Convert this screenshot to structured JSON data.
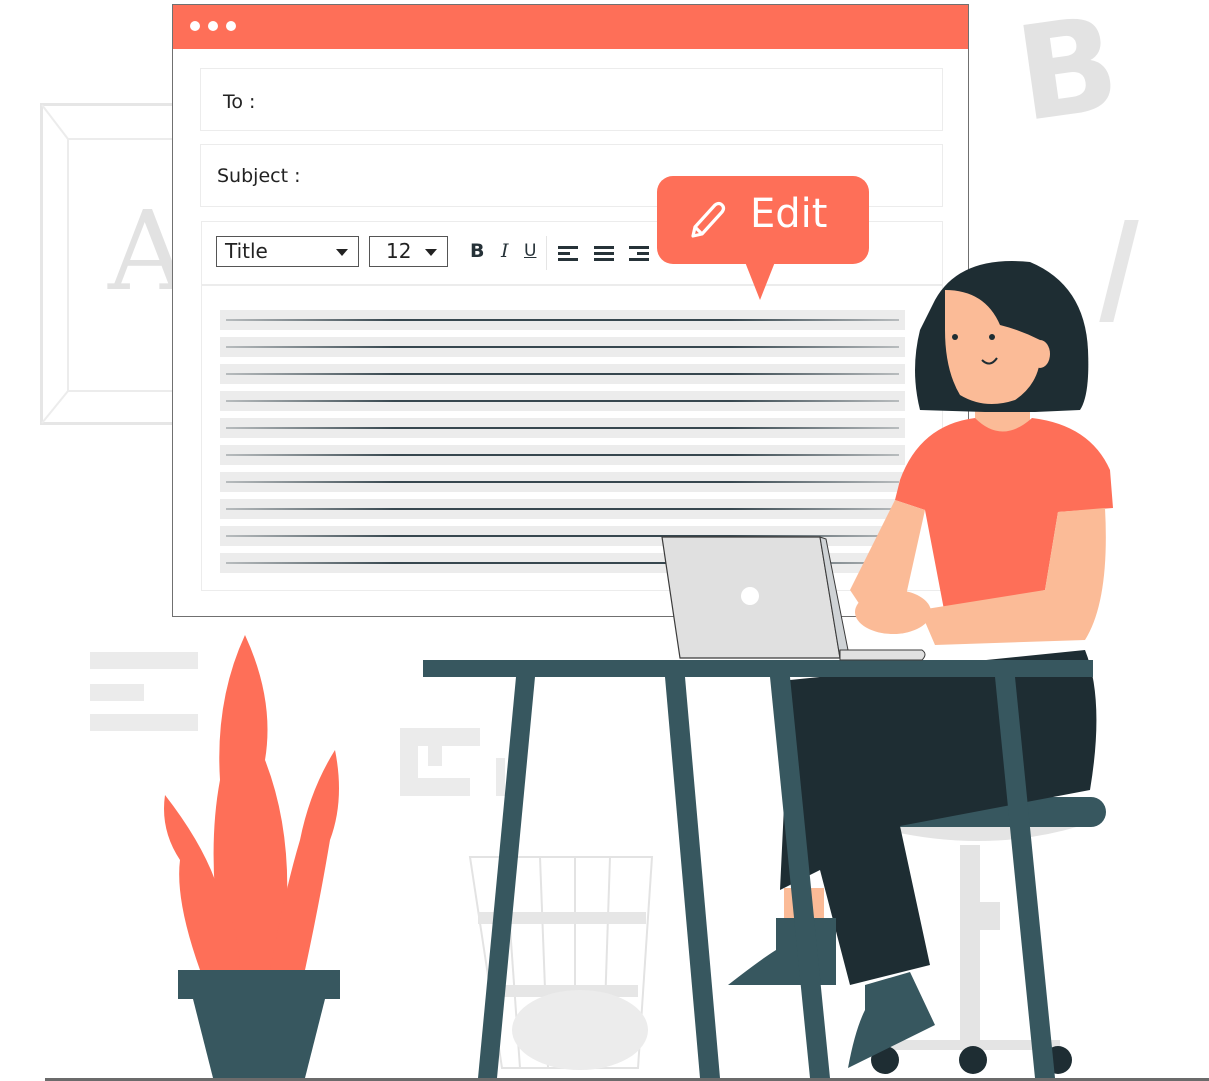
{
  "window": {
    "title_dots": 3,
    "accent_color": "#fe6f58",
    "to_label": "To :",
    "to_value": "",
    "subject_label": "Subject :",
    "subject_value": ""
  },
  "toolbar": {
    "style_select": "Title",
    "size_select": "12",
    "bold_label": "B",
    "italic_label": "I",
    "underline_label": "U",
    "align_icons": [
      "align-left-icon",
      "align-center-icon",
      "align-right-icon"
    ]
  },
  "editor": {
    "text_lines": 10
  },
  "edit_bubble": {
    "label": "Edit",
    "icon": "pencil-icon"
  },
  "background": {
    "letter_a": "A",
    "letter_b": "B"
  },
  "colors": {
    "coral": "#fe6f58",
    "dark_teal": "#37575f",
    "hair": "#1e2d33",
    "skin": "#fbbb97",
    "light_gray": "#e6e6e6"
  }
}
